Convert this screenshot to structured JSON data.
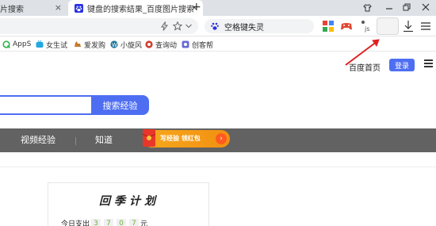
{
  "tabs": [
    {
      "label": "片搜索",
      "close": "×"
    },
    {
      "label": "键盘的搜索结果_百度图片搜索",
      "close": "×"
    }
  ],
  "new_tab": "+",
  "toolbar": {
    "search_pill_text": "空格键失灵"
  },
  "bookmarks": [
    {
      "label": "AppS",
      "color": "#2fb34a"
    },
    {
      "label": "女生试",
      "color": "#22a7e0"
    },
    {
      "label": "爱发购",
      "color": "#c67b2b"
    },
    {
      "label": "小旋风",
      "color": "#21759b"
    },
    {
      "label": "查询动",
      "color": "#d33a2c"
    },
    {
      "label": "创客帮",
      "color": "#6b6bd6"
    }
  ],
  "page": {
    "baidu_home": "百度首页",
    "login": "登录",
    "search_button": "搜索经验",
    "nav": [
      "视频经验",
      "知道"
    ],
    "promo_text": "写经验 领红包",
    "promo_arrow": "›",
    "plan": {
      "title": "回季计划",
      "prefix": "今日支出",
      "digits": [
        "3",
        "7",
        "0",
        "7"
      ],
      "unit": "元"
    }
  },
  "colors": {
    "accent": "#4e6ef2",
    "navbar": "#626262",
    "promo": "#f29012",
    "annotation": "#e02020"
  }
}
